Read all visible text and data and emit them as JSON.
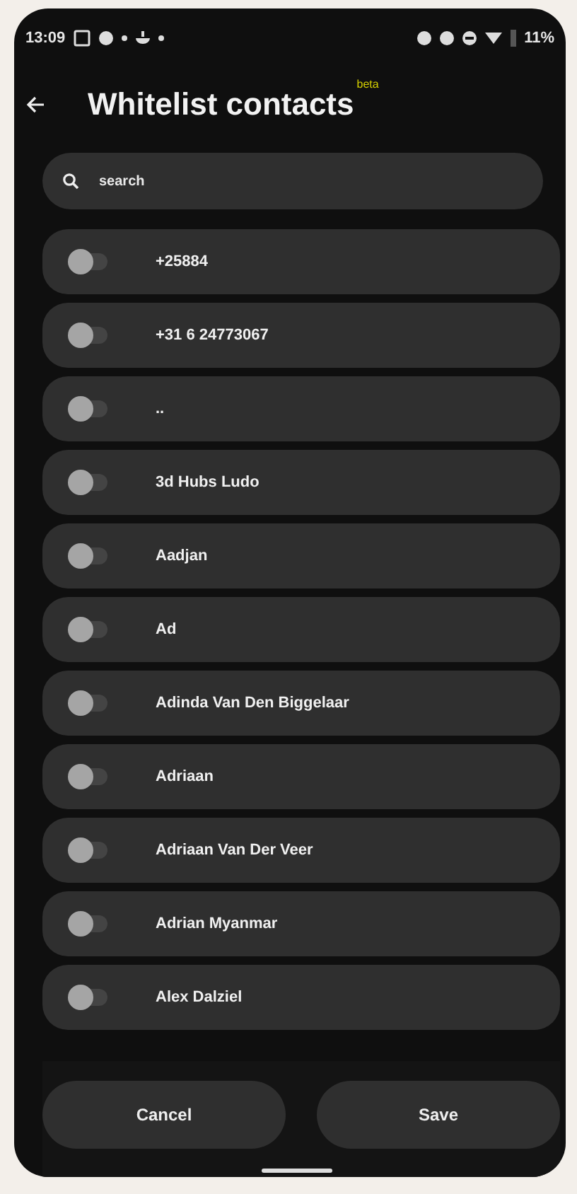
{
  "status_bar": {
    "time": "13:09",
    "battery": "11%"
  },
  "header": {
    "title": "Whitelist contacts",
    "badge": "beta"
  },
  "search": {
    "placeholder": "search"
  },
  "contacts": [
    {
      "name": "+25884",
      "on": false
    },
    {
      "name": "+31 6 24773067",
      "on": false
    },
    {
      "name": "..",
      "on": false
    },
    {
      "name": "3d Hubs Ludo",
      "on": false
    },
    {
      "name": "Aadjan",
      "on": false
    },
    {
      "name": "Ad",
      "on": false
    },
    {
      "name": "Adinda Van Den Biggelaar",
      "on": false
    },
    {
      "name": "Adriaan",
      "on": false
    },
    {
      "name": "Adriaan Van Der Veer",
      "on": false
    },
    {
      "name": "Adrian Myanmar",
      "on": false
    },
    {
      "name": "Alex Dalziel",
      "on": false
    }
  ],
  "buttons": [
    "Cancel",
    "Save"
  ]
}
